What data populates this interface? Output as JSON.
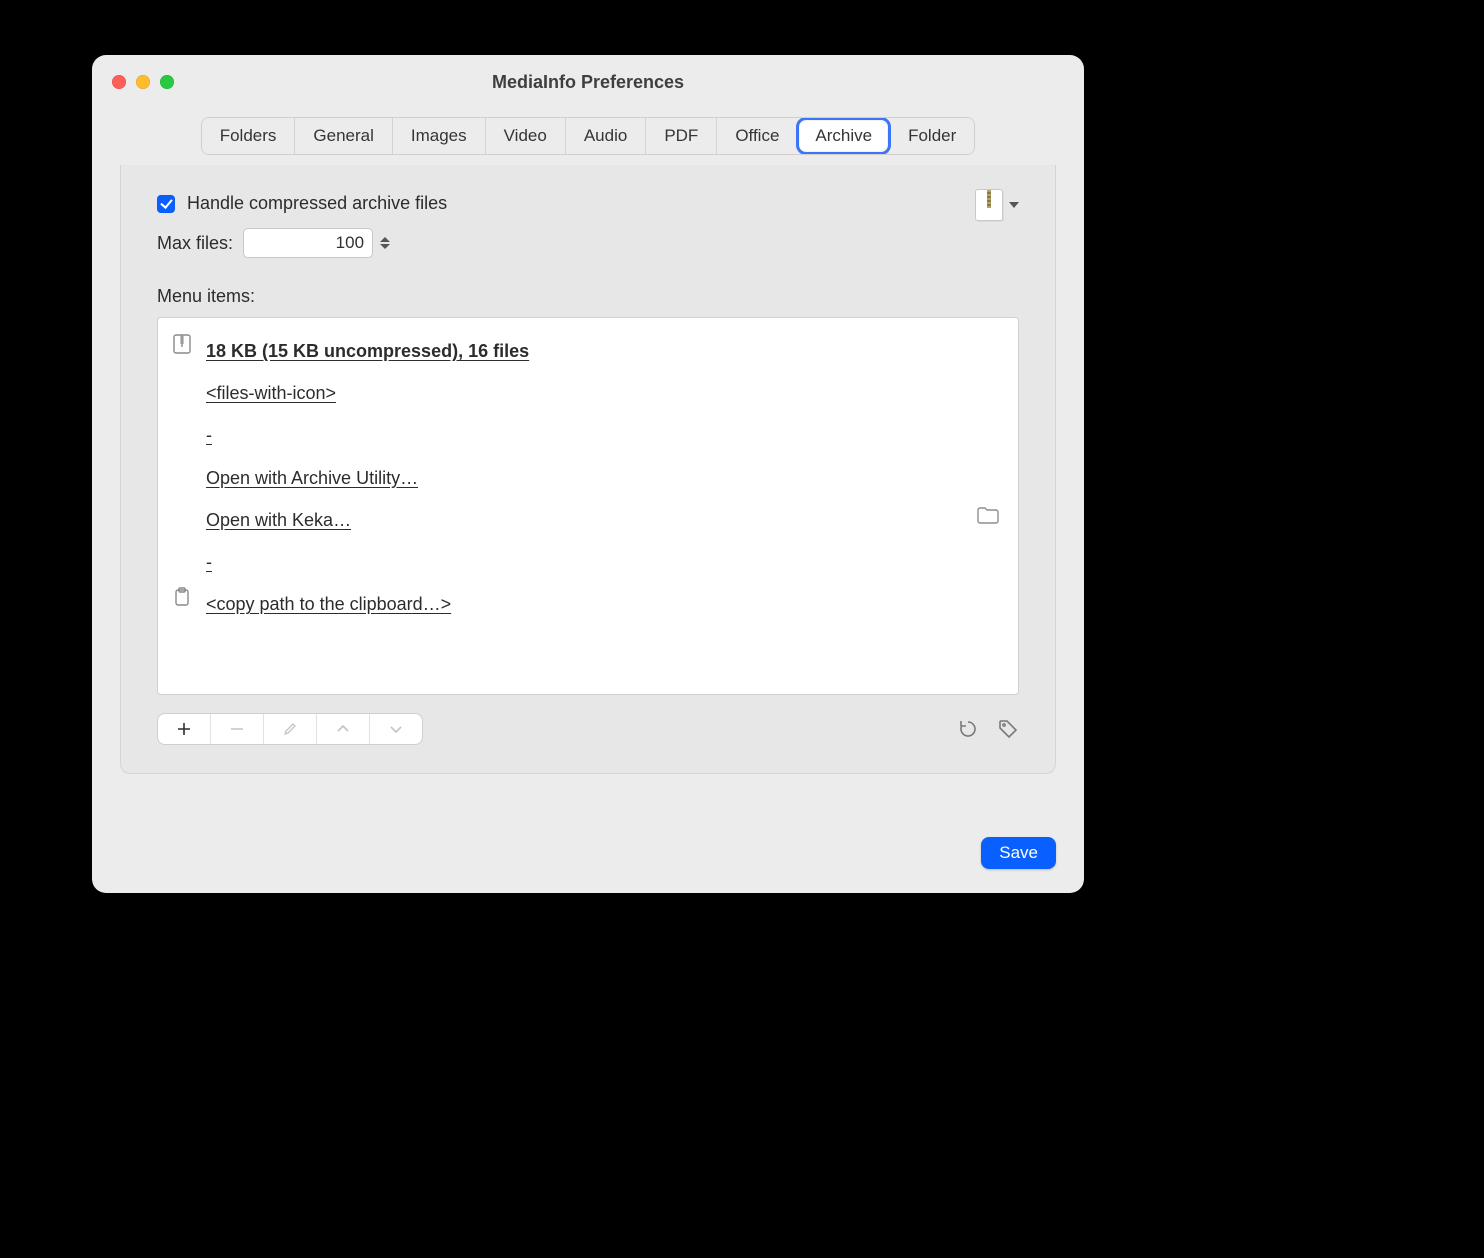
{
  "window": {
    "title": "MediaInfo Preferences"
  },
  "tabs": [
    "Folders",
    "General",
    "Images",
    "Video",
    "Audio",
    "PDF",
    "Office",
    "Archive",
    "Folder"
  ],
  "active_tab": "Archive",
  "archive": {
    "handle_checkbox_label": "Handle compressed archive files",
    "handle_checked": true,
    "max_files_label": "Max files:",
    "max_files_value": "100",
    "menu_items_label": "Menu items:",
    "items": [
      {
        "icon": "zip-icon",
        "text": "18 KB (15 KB uncompressed), 16 files",
        "bold": true
      },
      {
        "icon": null,
        "text": "<files-with-icon>"
      },
      {
        "icon": null,
        "text": "-"
      },
      {
        "icon": null,
        "text": "Open with Archive Utility…"
      },
      {
        "icon": null,
        "text": "Open with Keka…",
        "trailing": "folder-icon"
      },
      {
        "icon": null,
        "text": "-"
      },
      {
        "icon": "clipboard-icon",
        "text": "<copy path to the clipboard…>"
      }
    ]
  },
  "footer": {
    "save_label": "Save"
  }
}
